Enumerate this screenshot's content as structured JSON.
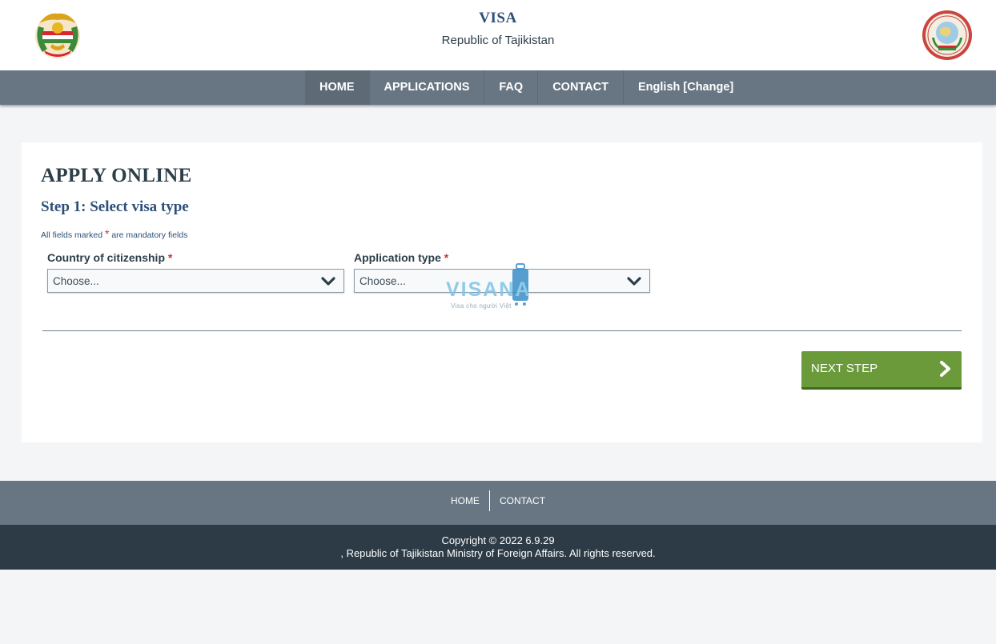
{
  "header": {
    "title": "VISA",
    "subtitle": "Republic of Tajikistan",
    "left_emblem_icon": "state-emblem-icon",
    "right_emblem_icon": "ministry-seal-icon"
  },
  "nav": {
    "items": [
      {
        "label": "HOME"
      },
      {
        "label": "APPLICATIONS"
      },
      {
        "label": "FAQ"
      },
      {
        "label": "CONTACT"
      },
      {
        "label": "English [Change]"
      }
    ]
  },
  "form": {
    "title": "APPLY ONLINE",
    "step": "Step 1: Select visa type",
    "mandatory_prefix": "All fields marked",
    "mandatory_star": "*",
    "mandatory_suffix": "are mandatory fields",
    "country": {
      "label": "Country of citizenship",
      "value": "Choose..."
    },
    "app_type": {
      "label": "Application type",
      "value": "Choose..."
    },
    "next_label": "NEXT STEP"
  },
  "watermark": {
    "text": "VISANA",
    "tagline": "Visa cho người Việt"
  },
  "footer": {
    "links": [
      {
        "label": "HOME"
      },
      {
        "label": "CONTACT"
      }
    ],
    "copyright": "Copyright © 2022  6.9.29",
    "rights": ", Republic of Tajikistan Ministry of Foreign Affairs. All rights reserved."
  },
  "colors": {
    "nav": "#687683",
    "footer_dark": "#2c3b45",
    "accent_green": "#6a9a3a",
    "title_blue": "#2e4f7a",
    "required_red": "#c0392b"
  }
}
